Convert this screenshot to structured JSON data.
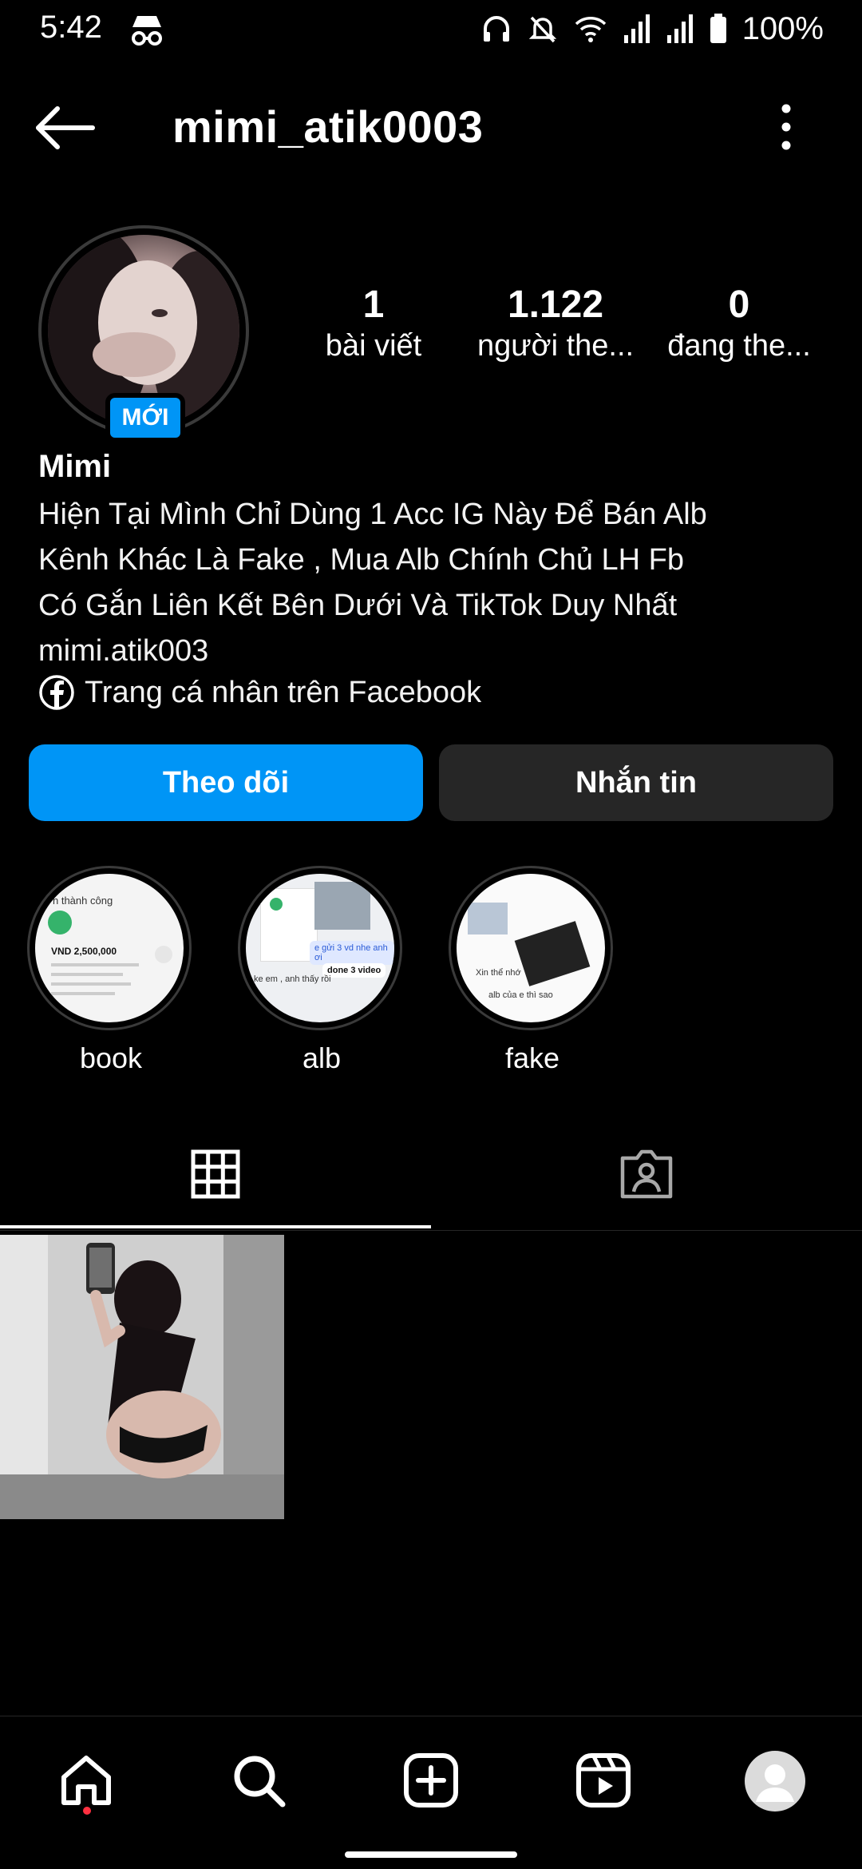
{
  "status_bar": {
    "time": "5:42",
    "battery_text": "100%",
    "icons": [
      "incognito-icon",
      "headphones-icon",
      "bell-muted-icon",
      "wifi-icon",
      "signal-icon",
      "signal-icon-2",
      "battery-icon"
    ]
  },
  "header": {
    "username": "mimi_atik0003"
  },
  "profile": {
    "new_badge": "MỚI",
    "display_name": "Mimi",
    "stats": [
      {
        "value": "1",
        "label": "bài viết"
      },
      {
        "value": "1.122",
        "label": "người the..."
      },
      {
        "value": "0",
        "label": "đang the..."
      }
    ],
    "bio_lines": [
      "Hiện Tại Mình Chỉ Dùng 1 Acc IG Này Để Bán Alb",
      "Kênh Khác Là Fake , Mua Alb Chính Chủ LH Fb",
      "Có Gắn Liên Kết Bên Dưới Và TikTok Duy Nhất",
      "mimi.atik003"
    ],
    "facebook_link": "Trang cá nhân trên Facebook"
  },
  "actions": {
    "follow_label": "Theo dõi",
    "message_label": "Nhắn tin"
  },
  "highlights": [
    {
      "label": "book"
    },
    {
      "label": "alb"
    },
    {
      "label": "fake"
    }
  ],
  "highlight_snippets": {
    "book_title": "n thành công",
    "book_amount": "VND 2,500,000",
    "alb_msg": "e gửi 3 vd nhe anh ơi",
    "alb_msg2": "done 3 video",
    "alb_msg3": "ke em , anh thấy rồi",
    "fake_msg": "Xin thể nhớ",
    "fake_msg2": "alb của e thì sao"
  },
  "colors": {
    "accent": "#0095f6",
    "secondary_button": "#262626",
    "notification_dot": "#ff3040"
  }
}
